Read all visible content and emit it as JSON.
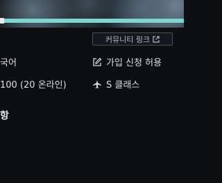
{
  "header": {
    "progress": 1.0
  },
  "community_link": {
    "label": "커뮤니티 링크",
    "icon": "external-link-icon"
  },
  "info": {
    "language": "국어",
    "join_policy": "가입 신청 허용",
    "join_policy_icon": "edit-icon",
    "members": "100 (20 온라인)",
    "class": "S 클래스",
    "class_icon": "airplane-icon"
  },
  "section": {
    "title": "항"
  },
  "colors": {
    "accent": "#7fd5cf",
    "background": "#0d0f12"
  }
}
